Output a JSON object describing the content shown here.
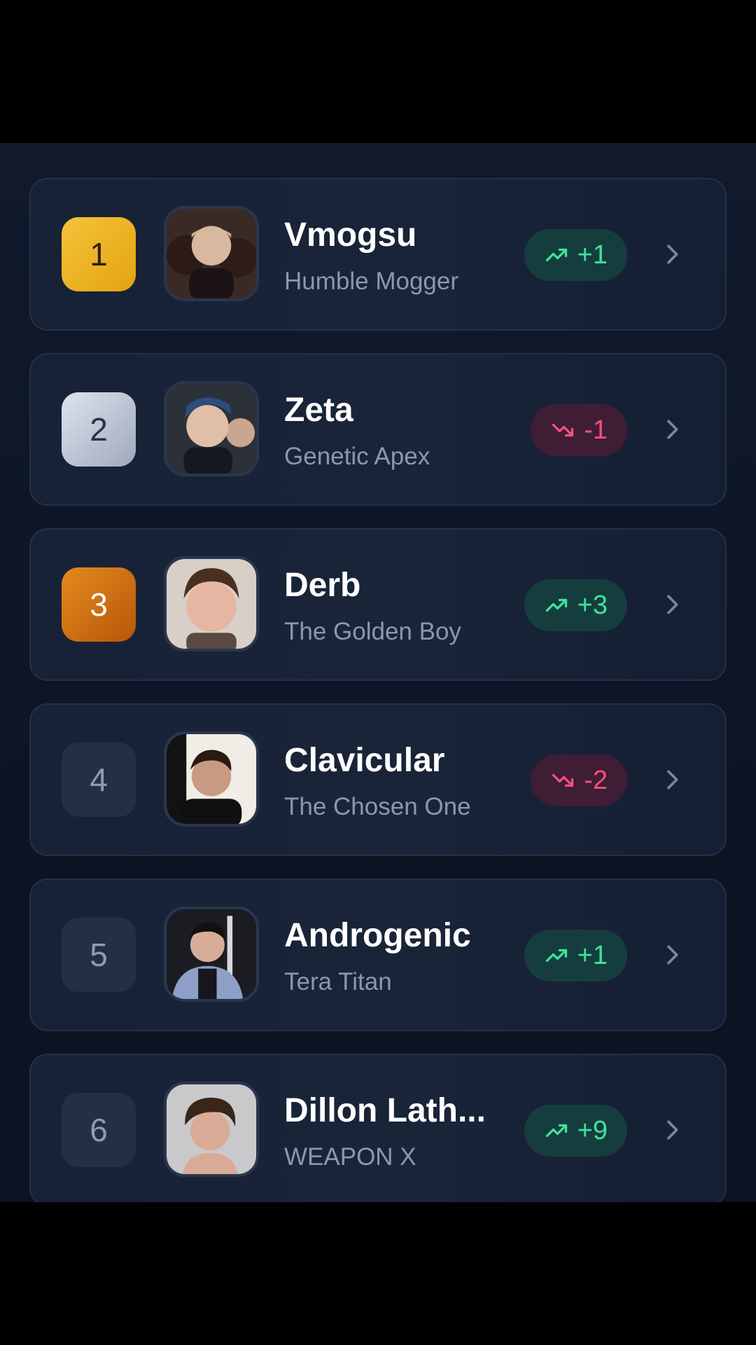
{
  "leaderboard": {
    "entries": [
      {
        "rank": "1",
        "name": "Vmogsu",
        "subtitle": "Humble Mogger",
        "change": "+1",
        "direction": "up",
        "avatar_icon": "avatar-photo-icon"
      },
      {
        "rank": "2",
        "name": "Zeta",
        "subtitle": "Genetic Apex",
        "change": "-1",
        "direction": "down",
        "avatar_icon": "avatar-photo-icon"
      },
      {
        "rank": "3",
        "name": "Derb",
        "subtitle": "The Golden Boy",
        "change": "+3",
        "direction": "up",
        "avatar_icon": "avatar-photo-icon"
      },
      {
        "rank": "4",
        "name": "Clavicular",
        "subtitle": "The Chosen One",
        "change": "-2",
        "direction": "down",
        "avatar_icon": "avatar-photo-icon"
      },
      {
        "rank": "5",
        "name": "Androgenic",
        "subtitle": "Tera Titan",
        "change": "+1",
        "direction": "up",
        "avatar_icon": "avatar-photo-icon"
      },
      {
        "rank": "6",
        "name": "Dillon Lath...",
        "subtitle": "WEAPON X",
        "change": "+9",
        "direction": "up",
        "avatar_icon": "avatar-photo-icon"
      }
    ]
  },
  "colors": {
    "background": "#0d1526",
    "card": "#1a2438",
    "gold": "#f0b824",
    "silver": "#c5ccd9",
    "bronze": "#d07214",
    "up": "#3ee39a",
    "down": "#ff4f7b"
  }
}
